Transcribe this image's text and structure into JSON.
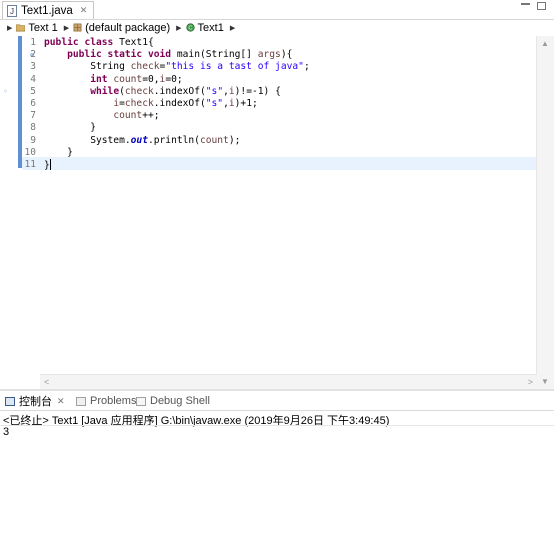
{
  "editor_tab": {
    "title": "Text1.java",
    "close": "✕"
  },
  "breadcrumb": {
    "items": [
      {
        "label": "Text 1",
        "icon": "java-project-icon"
      },
      {
        "label": "(default package)",
        "icon": "package-icon"
      },
      {
        "label": "Text1",
        "icon": "class-icon"
      }
    ]
  },
  "editor": {
    "line_numbers": [
      "1",
      "2",
      "3",
      "4",
      "5",
      "6",
      "7",
      "8",
      "9",
      "10",
      "11"
    ],
    "fold_markers": {
      "2": "⊖",
      "5": "◦"
    }
  },
  "console": {
    "tabs": [
      {
        "label": "控制台",
        "icon": "console-icon",
        "active": true,
        "close": "✕"
      },
      {
        "label": "Problems",
        "icon": "problems-icon",
        "active": false
      },
      {
        "label": "Debug Shell",
        "icon": "debug-shell-icon",
        "active": false
      }
    ],
    "status": "<已终止> Text1 [Java 应用程序] G:\\bin\\javaw.exe  (2019年9月26日 下午3:49:45)",
    "output": "3"
  },
  "colors": {
    "keyword": "#7f0055",
    "string": "#2a00ff",
    "variable": "#6a3e3e",
    "field": "#0000c0",
    "current_line": "#e8f2fe",
    "marker": "#5e90d2"
  }
}
